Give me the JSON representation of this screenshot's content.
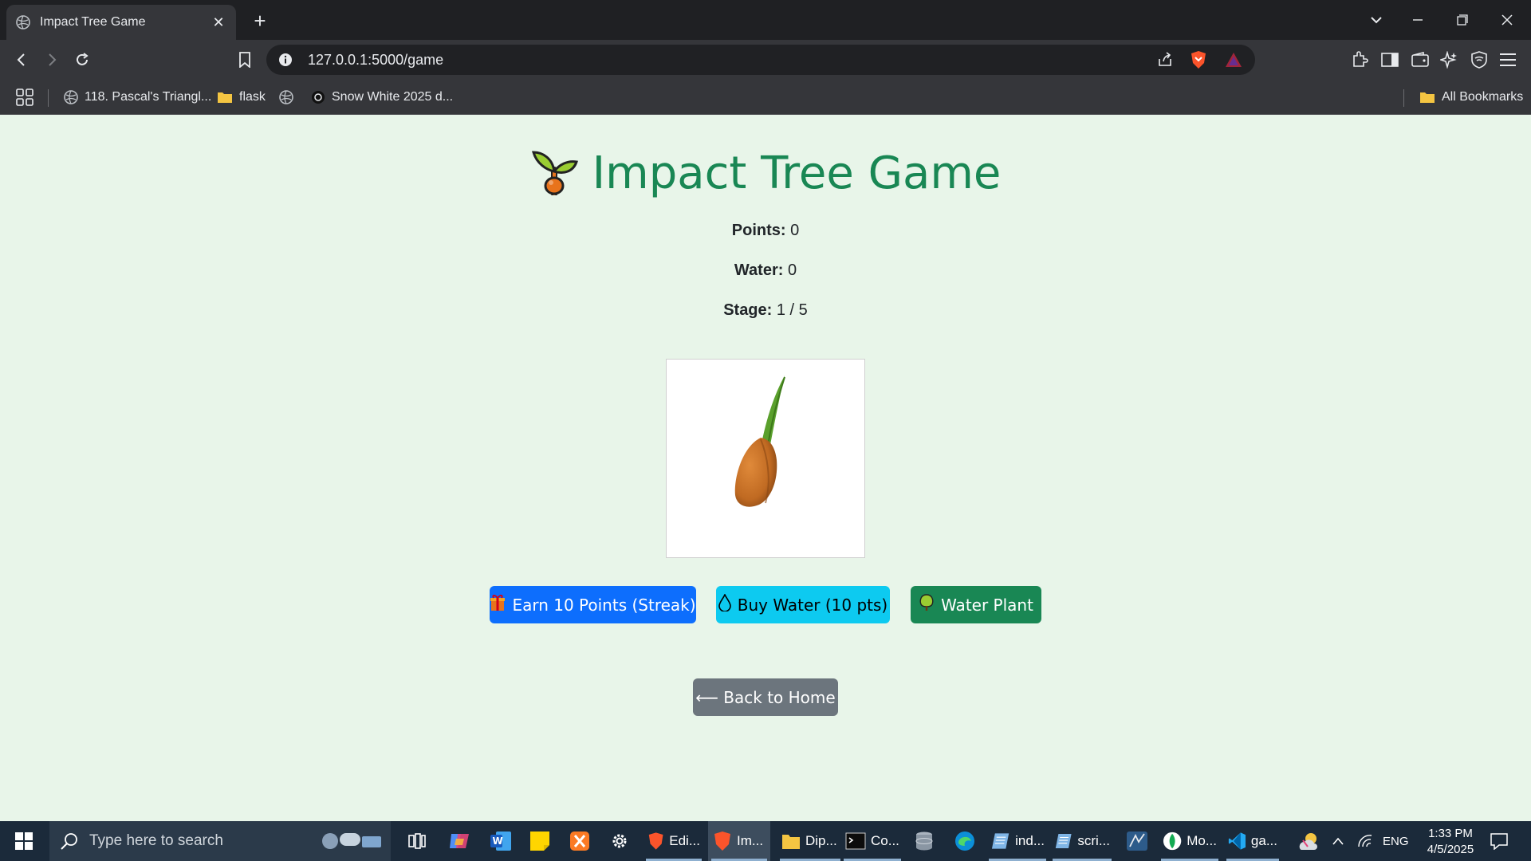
{
  "browser": {
    "tab_title": "Impact Tree Game",
    "url": "127.0.0.1:5000/game",
    "bookmarks": [
      {
        "label": "118. Pascal's Triangl..."
      },
      {
        "label": "flask"
      },
      {
        "label": ""
      },
      {
        "label": "Snow White 2025 d..."
      }
    ],
    "all_bookmarks": "All Bookmarks"
  },
  "game": {
    "title": "Impact Tree Game",
    "points_label": "Points:",
    "points_value": "0",
    "water_label": "Water:",
    "water_value": "0",
    "stage_label": "Stage:",
    "stage_value": "1 / 5",
    "plant_image_alt": "seed",
    "buttons": {
      "earn": "Earn 10 Points (Streak)",
      "buy_water": "Buy Water (10 pts)",
      "water_plant": "Water Plant",
      "back_home": "⟵ Back to Home"
    }
  },
  "taskbar": {
    "search_placeholder": "Type here to search",
    "apps": [
      {
        "label": "Edi..."
      },
      {
        "label": "Im..."
      },
      {
        "label": "Dip..."
      },
      {
        "label": "Co..."
      },
      {
        "label": "ind..."
      },
      {
        "label": "scri..."
      },
      {
        "label": "Mo..."
      },
      {
        "label": "ga..."
      }
    ],
    "language": "ENG",
    "time": "1:33 PM",
    "date": "4/5/2025"
  },
  "colors": {
    "page_bg": "#e8f5e9",
    "brand_green": "#198754",
    "primary": "#0d6efd",
    "info": "#0dcaf0",
    "secondary": "#6c757d"
  }
}
